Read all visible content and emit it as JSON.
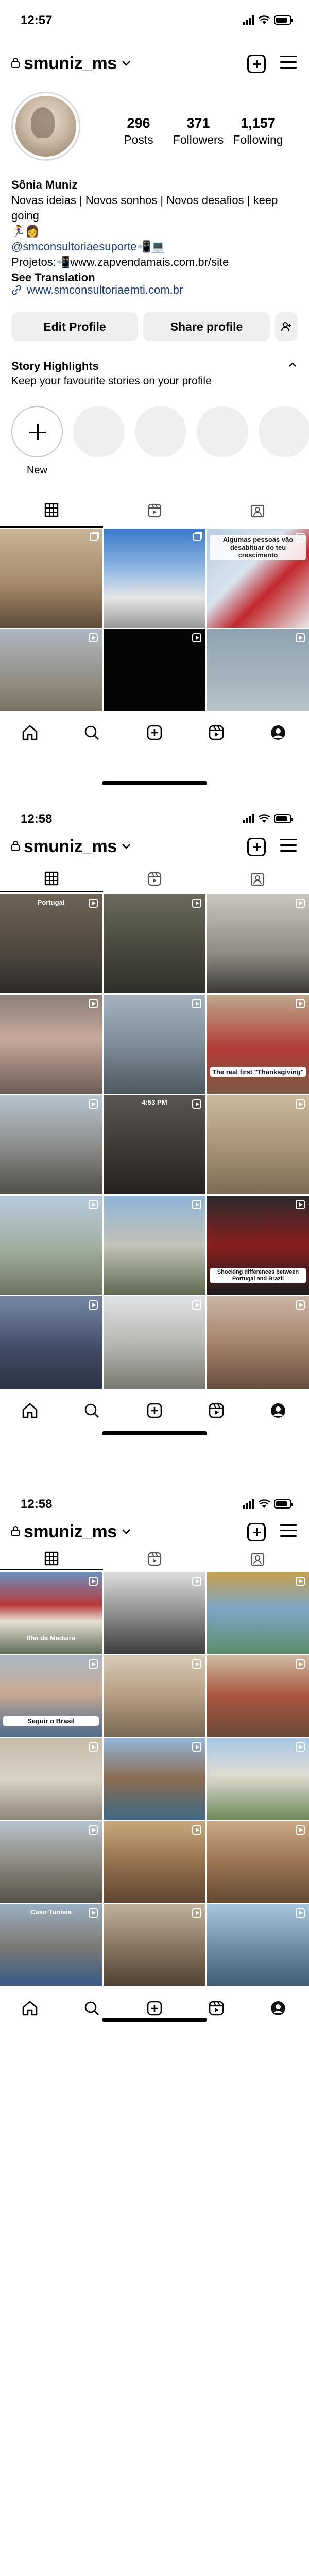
{
  "screens": [
    {
      "status_time": "12:57",
      "username": "smuniz_ms",
      "profile": {
        "posts": "296",
        "posts_label": "Posts",
        "followers": "371",
        "followers_label": "Followers",
        "following": "1,157",
        "following_label": "Following",
        "name": "Sônia Muniz",
        "bio_line1": "Novas ideias | Novos sonhos | Novos desafios | keep going",
        "bio_line2": "🏃‍♀️👩",
        "mention": "@smconsultoriaesuporte",
        "mention_suffix": "📲💻",
        "projects_prefix": "Projetos:📲",
        "projects_link": "www.zapvendamais.com.br/site",
        "see_translation": "See Translation",
        "external_link": "www.smconsultoriaemti.com.br"
      },
      "buttons": {
        "edit": "Edit Profile",
        "share": "Share profile"
      },
      "highlights": {
        "title": "Story Highlights",
        "subtitle": "Keep your favourite stories on your profile",
        "new_label": "New"
      },
      "grid_captions": {
        "c2": "Algumas pessoas vão desabituar do teu crescimento"
      }
    },
    {
      "status_time": "12:58",
      "username": "smuniz_ms",
      "grid_captions": {
        "c0": "Portugal",
        "c5": "The real first \"Thanksgiving\"",
        "c12": "Shocking differences between Portugal and Brazil",
        "c13": "4:53 PM"
      }
    },
    {
      "status_time": "12:58",
      "username": "smuniz_ms",
      "grid_captions": {
        "c0": "Ilha da Madeira",
        "c3": "Seguir o Brasil",
        "c12": "Caso Tunísia"
      }
    }
  ],
  "icons": {
    "lock": "lock-icon",
    "chevron": "chevron-down-icon",
    "plus": "plus-square-icon",
    "menu": "menu-icon",
    "link": "link-icon",
    "add_person": "add-person-icon",
    "grid": "grid-icon",
    "reels": "reels-icon",
    "tagged": "tagged-icon",
    "home": "home-icon",
    "search": "search-icon",
    "create": "create-icon",
    "reels_nav": "reels-nav-icon",
    "profile": "profile-icon"
  },
  "colors": {
    "link": "#1c3f7c",
    "button_bg": "#efefef",
    "highlight_bg": "#efefef"
  }
}
